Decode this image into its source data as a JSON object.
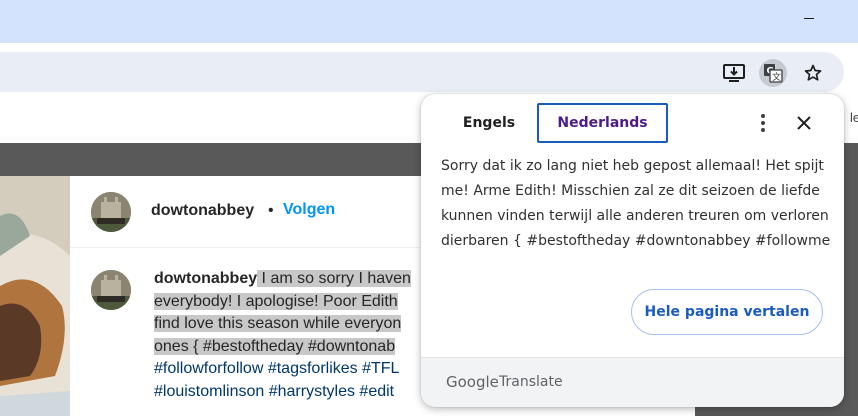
{
  "browser": {
    "minimize_icon": "minimize-icon",
    "toolbar_icons": [
      "install-app-icon",
      "translate-icon",
      "bookmark-star-icon"
    ],
    "edge_letter": "le"
  },
  "post": {
    "header_username": "dowtonabbey",
    "separator": "•",
    "follow_label": "Volgen",
    "caption_username": "dowtonabbey",
    "caption_lines": [
      " I am so sorry I haven",
      "everybody! I apologise! Poor Edith",
      "find love this season while everyon",
      "ones { #bestoftheday #downtonab"
    ],
    "hashtag_lines": [
      "#followforfollow #tagsforlikes #TFL",
      "#louistomlinson #harrystyles #edit"
    ]
  },
  "translate_bubble": {
    "source_language": "Engels",
    "target_language": "Nederlands",
    "translated_text": "Sorry dat ik zo lang niet heb gepost allemaal! Het spijt me! Arme Edith! Misschien zal ze dit seizoen de liefde kunnen vinden terwijl alle anderen treuren om verloren dierbaren { #bestoftheday #downtonabbey #followme",
    "translate_page_label": "Hele pagina vertalen",
    "footer_brand": "Google",
    "footer_product": "Translate",
    "accent_color": "#1a5bbf",
    "selected_language_color": "#4c1a8a"
  }
}
